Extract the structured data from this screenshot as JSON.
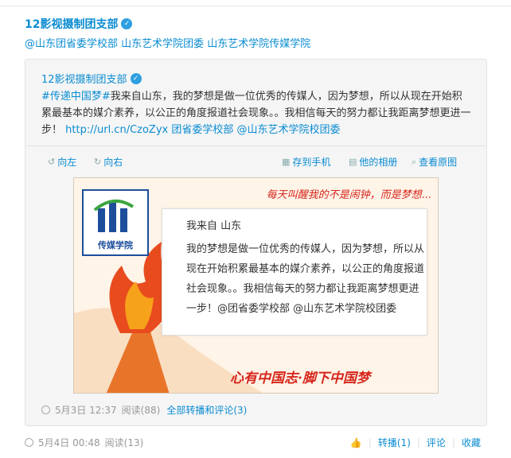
{
  "author": {
    "name": "12影视摄制团支部",
    "verified_icon": "verified-badge-icon"
  },
  "mentions": "@山东团省委学校部 山东艺术学院团委 山东艺术学院传媒学院",
  "quoted": {
    "author": "12影视摄制团支部",
    "text_topic": "#传递中国梦#",
    "text_body": "我来自山东，我的梦想是做一位优秀的传媒人，因为梦想，所以从现在开始积累最基本的媒介素养，以公正的角度报道社会现象。。我相信每天的努力都让我距离梦想更进一步！",
    "text_link": "http://url.cn/CzoZyx",
    "text_mentions": "团省委学校部 @山东艺术学院校团委",
    "toolbar": {
      "rotate_left": "向左",
      "rotate_right": "向右",
      "save_to_phone": "存到手机",
      "album": "他的相册",
      "view_original": "查看原图"
    },
    "image": {
      "logo_name": "传媒学院",
      "slogan": "每天叫醒我的不是闹钟，而是梦想...",
      "hello": "我来自 山东",
      "body": "我的梦想是做一位优秀的传媒人，因为梦想，所以从现在开始积累最基本的媒介素养，以公正的角度报道社会现象。。我相信每天的努力都让我距离梦想更进一步！@团省委学校部 @山东艺术学院校团委",
      "bottom_text": "心有中国志·脚下中国梦"
    },
    "meta": {
      "time": "5月3日 12:37",
      "reads": "阅读(88)",
      "all_label": "全部转播和评论(3)"
    }
  },
  "footer": {
    "time": "5月4日 00:48",
    "reads": "阅读(13)",
    "like_icon": "thumbs-up-icon",
    "repost": "转播(1)",
    "comment": "评论",
    "favorite": "收藏"
  },
  "colors": {
    "link": "#0a8cd2",
    "accent_red": "#d6261c",
    "logo_blue": "#1d4e9c"
  }
}
